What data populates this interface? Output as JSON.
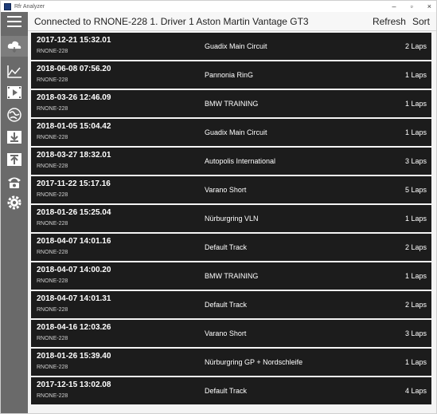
{
  "window": {
    "title": "Rfr Analyzer",
    "controls": {
      "minimize": "–",
      "maximize": "▫",
      "close": "×"
    }
  },
  "header": {
    "connection_text": "Connected to RNONE-228 1. Driver 1 Aston Martin Vantage GT3",
    "refresh_label": "Refresh",
    "sort_label": "Sort"
  },
  "sidebar": {
    "icons": [
      "cloud-icon",
      "chart-icon",
      "video-icon",
      "globe-icon",
      "download-icon",
      "upload-icon",
      "telephone-icon",
      "settings-icon"
    ]
  },
  "sessions": [
    {
      "datetime": "2017-12-21 15:32.01",
      "device": "RNONE-228",
      "track": "Guadix Main Circuit",
      "laps": "2 Laps"
    },
    {
      "datetime": "2018-06-08 07:56.20",
      "device": "RNONE-228",
      "track": "Pannonia RinG",
      "laps": "1 Laps"
    },
    {
      "datetime": "2018-03-26 12:46.09",
      "device": "RNONE-228",
      "track": "BMW TRAINING",
      "laps": "1 Laps"
    },
    {
      "datetime": "2018-01-05 15:04.42",
      "device": "RNONE-228",
      "track": "Guadix Main Circuit",
      "laps": "1 Laps"
    },
    {
      "datetime": "2018-03-27 18:32.01",
      "device": "RNONE-228",
      "track": "Autopolis International",
      "laps": "3 Laps"
    },
    {
      "datetime": "2017-11-22 15:17.16",
      "device": "RNONE-228",
      "track": "Varano Short",
      "laps": "5 Laps"
    },
    {
      "datetime": "2018-01-26 15:25.04",
      "device": "RNONE-228",
      "track": "Nürburgring VLN",
      "laps": "1 Laps"
    },
    {
      "datetime": "2018-04-07 14:01.16",
      "device": "RNONE-228",
      "track": "Default Track",
      "laps": "2 Laps"
    },
    {
      "datetime": "2018-04-07 14:00.20",
      "device": "RNONE-228",
      "track": "BMW TRAINING",
      "laps": "1 Laps"
    },
    {
      "datetime": "2018-04-07 14:01.31",
      "device": "RNONE-228",
      "track": "Default Track",
      "laps": "2 Laps"
    },
    {
      "datetime": "2018-04-16 12:03.26",
      "device": "RNONE-228",
      "track": "Varano Short",
      "laps": "3 Laps"
    },
    {
      "datetime": "2018-01-26 15:39.40",
      "device": "RNONE-228",
      "track": "Nürburgring GP + Nordschleife",
      "laps": "1 Laps"
    },
    {
      "datetime": "2017-12-15 13:02.08",
      "device": "RNONE-228",
      "track": "Default Track",
      "laps": "4 Laps"
    }
  ],
  "colors": {
    "sidebar": "#6a6a6a",
    "row_background": "#1c1c1c",
    "row_text": "#ffffff"
  }
}
